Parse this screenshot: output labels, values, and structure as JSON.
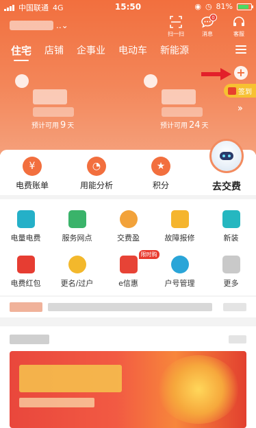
{
  "status_bar": {
    "carrier": "中国联通",
    "network": "4G",
    "time": "15:50",
    "battery": "81%",
    "battery_level": 0.81
  },
  "header": {
    "scan_label": "扫一扫",
    "messages_label": "消息",
    "messages_count": "0",
    "service_label": "客服"
  },
  "tabs": [
    "住宅",
    "店铺",
    "企事业",
    "电动车",
    "新能源"
  ],
  "accounts": [
    {
      "prefix": "预计可用",
      "days": "9",
      "suffix": "天"
    },
    {
      "prefix": "预计可用",
      "days": "24",
      "suffix": "天"
    }
  ],
  "signin_label": "签到",
  "quick_actions": [
    {
      "label": "电费账单",
      "icon": "yuan-icon"
    },
    {
      "label": "用能分析",
      "icon": "pie-chart-icon"
    },
    {
      "label": "积分",
      "icon": "star-icon"
    }
  ],
  "go_pay_label": "去交费",
  "services": [
    {
      "label": "电量电费",
      "icon": "screen-icon",
      "color": "#25b0c8"
    },
    {
      "label": "服务网点",
      "icon": "map-pin-icon",
      "color": "#3ab36a"
    },
    {
      "label": "交费盈",
      "icon": "piggy-bank-icon",
      "color": "#f2a23a"
    },
    {
      "label": "故障报修",
      "icon": "lightning-icon",
      "color": "#f5b52e"
    },
    {
      "label": "新装",
      "icon": "meter-icon",
      "color": "#25b7c0"
    },
    {
      "label": "电费红包",
      "icon": "red-envelope-icon",
      "color": "#e63d32"
    },
    {
      "label": "更名/过户",
      "icon": "users-icon",
      "color": "#f3b82c"
    },
    {
      "label": "e信惠",
      "icon": "cart-icon",
      "color": "#e74336",
      "tag": "限时购"
    },
    {
      "label": "户号管理",
      "icon": "user-gear-icon",
      "color": "#2aa5d8"
    },
    {
      "label": "更多",
      "icon": "grid-icon",
      "color": "#c9c9c9"
    }
  ]
}
